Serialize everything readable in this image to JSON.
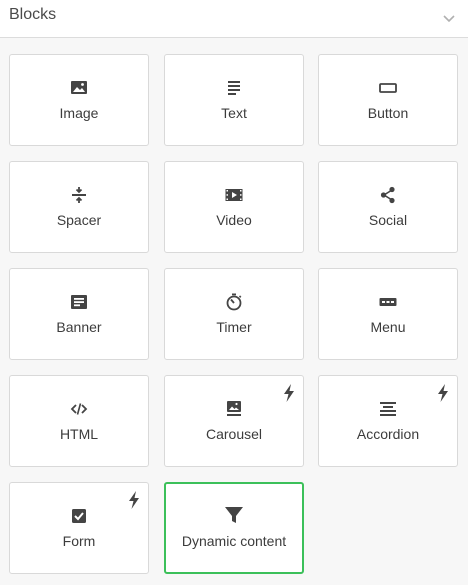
{
  "panel": {
    "title": "Blocks"
  },
  "blocks": [
    {
      "label": "Image",
      "icon": "image-icon"
    },
    {
      "label": "Text",
      "icon": "text-icon"
    },
    {
      "label": "Button",
      "icon": "button-icon"
    },
    {
      "label": "Spacer",
      "icon": "spacer-icon"
    },
    {
      "label": "Video",
      "icon": "video-icon"
    },
    {
      "label": "Social",
      "icon": "share-icon"
    },
    {
      "label": "Banner",
      "icon": "banner-icon"
    },
    {
      "label": "Timer",
      "icon": "timer-icon"
    },
    {
      "label": "Menu",
      "icon": "menu-icon"
    },
    {
      "label": "HTML",
      "icon": "code-icon"
    },
    {
      "label": "Carousel",
      "icon": "carousel-icon",
      "badge": "bolt-icon"
    },
    {
      "label": "Accordion",
      "icon": "accordion-icon",
      "badge": "bolt-icon"
    },
    {
      "label": "Form",
      "icon": "checkbox-icon",
      "badge": "bolt-icon"
    },
    {
      "label": "Dynamic content",
      "icon": "filter-icon",
      "selected": true
    }
  ],
  "colors": {
    "selected_border": "#3cc05a",
    "icon": "#444444",
    "tile_border": "#d9d9d9"
  }
}
